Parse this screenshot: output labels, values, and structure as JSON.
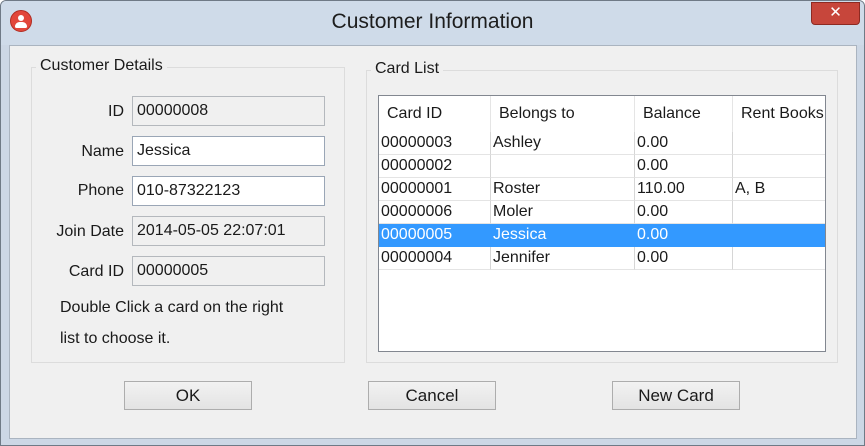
{
  "window": {
    "title": "Customer Information",
    "close_glyph": "✕",
    "app_icon": "user-icon",
    "close_color": "#c7463b"
  },
  "customer_details": {
    "group_label": "Customer Details",
    "fields": {
      "id": {
        "label": "ID",
        "value": "00000008"
      },
      "name": {
        "label": "Name",
        "value": "Jessica"
      },
      "phone": {
        "label": "Phone",
        "value": "010-87322123"
      },
      "join_date": {
        "label": "Join Date",
        "value": "2014-05-05 22:07:01"
      },
      "card_id": {
        "label": "Card ID",
        "value": "00000005"
      }
    },
    "hint_line1": "Double Click a card on the right",
    "hint_line2": "list to choose it."
  },
  "card_list": {
    "group_label": "Card List",
    "columns": [
      "Card ID",
      "Belongs to",
      "Balance",
      "Rent Books"
    ],
    "rows": [
      [
        "00000003",
        "Ashley",
        "0.00",
        ""
      ],
      [
        "00000002",
        "",
        "0.00",
        ""
      ],
      [
        "00000001",
        "Roster",
        "110.00",
        "A, B"
      ],
      [
        "00000006",
        "Moler",
        "0.00",
        ""
      ],
      [
        "00000005",
        "Jessica",
        "0.00",
        ""
      ],
      [
        "00000004",
        "Jennifer",
        "0.00",
        ""
      ]
    ],
    "selected_row": 4,
    "selection_color": "#3399ff",
    "scroll_left": "<",
    "scroll_right": ">"
  },
  "buttons": {
    "ok": "OK",
    "cancel": "Cancel",
    "new_card": "New Card"
  }
}
